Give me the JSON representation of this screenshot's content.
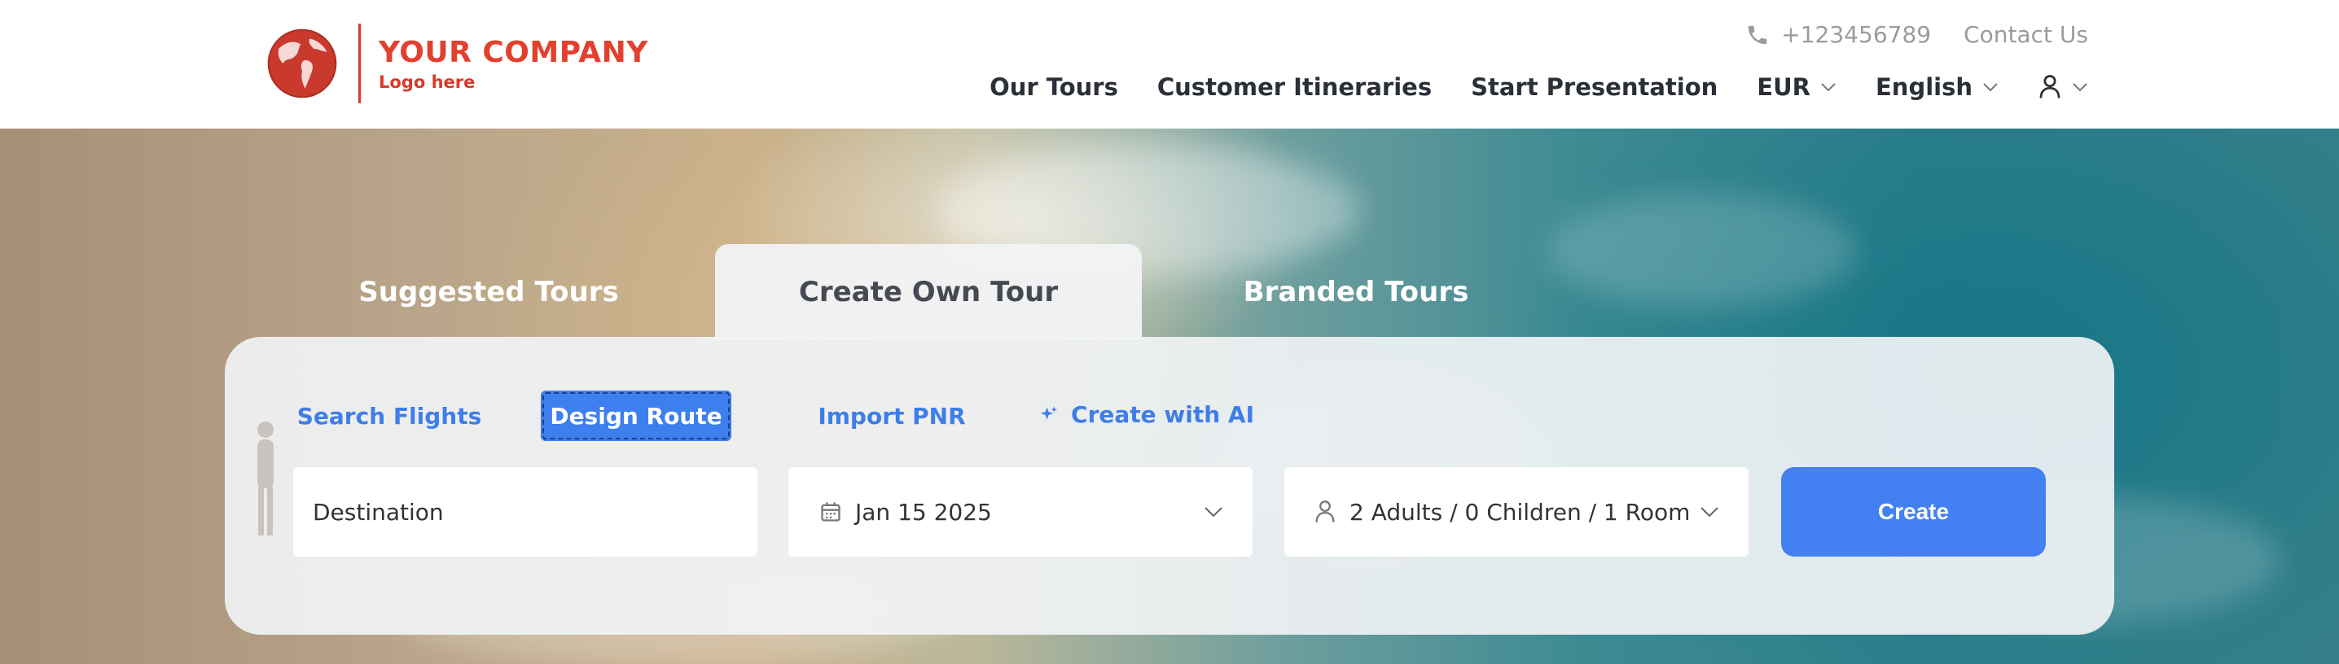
{
  "header": {
    "logo": {
      "company": "YOUR COMPANY",
      "tagline": "Logo here"
    },
    "contact": {
      "phone": "+123456789",
      "contact_link": "Contact Us"
    },
    "nav": {
      "our_tours": "Our Tours",
      "customer_itineraries": "Customer Itineraries",
      "start_presentation": "Start Presentation",
      "currency": "EUR",
      "language": "English"
    }
  },
  "tabs": {
    "suggested": "Suggested Tours",
    "create_own": "Create Own Tour",
    "branded": "Branded Tours"
  },
  "subtabs": {
    "search_flights": "Search Flights",
    "design_route": "Design Route",
    "import_pnr": "Import PNR",
    "create_ai": "Create with AI"
  },
  "form": {
    "destination_placeholder": "Destination",
    "date": "Jan 15 2025",
    "guests": "2 Adults / 0 Children / 1 Room",
    "create": "Create"
  },
  "colors": {
    "brand": "#e2402f",
    "accent": "#3d7fee",
    "nav_text": "#2a2f38"
  },
  "icons": [
    "globe-logo-icon",
    "phone-icon",
    "chevron-down-icon",
    "user-icon",
    "sparkle-icon",
    "calendar-icon",
    "person-icon"
  ]
}
